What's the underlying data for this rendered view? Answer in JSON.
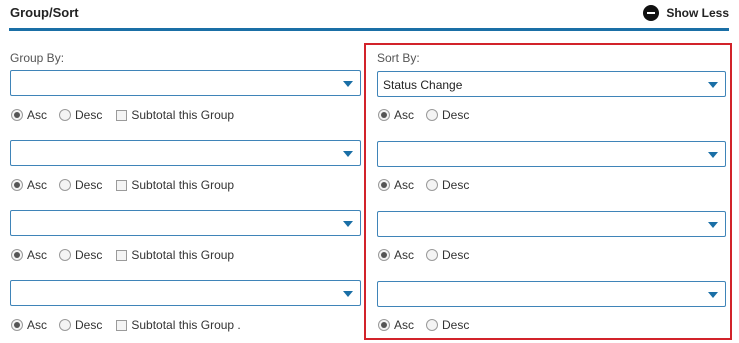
{
  "header": {
    "title": "Group/Sort",
    "show_less_label": "Show Less"
  },
  "group_by": {
    "label": "Group By:",
    "rows": [
      {
        "selected": "",
        "asc_label": "Asc",
        "desc_label": "Desc",
        "subtotal_label": "Subtotal this Group",
        "order": "asc",
        "subtotal": false
      },
      {
        "selected": "",
        "asc_label": "Asc",
        "desc_label": "Desc",
        "subtotal_label": "Subtotal this Group",
        "order": "asc",
        "subtotal": false
      },
      {
        "selected": "",
        "asc_label": "Asc",
        "desc_label": "Desc",
        "subtotal_label": "Subtotal this Group",
        "order": "asc",
        "subtotal": false
      },
      {
        "selected": "",
        "asc_label": "Asc",
        "desc_label": "Desc",
        "subtotal_label": "Subtotal this Group .",
        "order": "asc",
        "subtotal": false
      }
    ]
  },
  "sort_by": {
    "label": "Sort By:",
    "rows": [
      {
        "selected": "Status Change",
        "asc_label": "Asc",
        "desc_label": "Desc",
        "order": "asc"
      },
      {
        "selected": "",
        "asc_label": "Asc",
        "desc_label": "Desc",
        "order": "asc"
      },
      {
        "selected": "",
        "asc_label": "Asc",
        "desc_label": "Desc",
        "order": "asc"
      },
      {
        "selected": "",
        "asc_label": "Asc",
        "desc_label": "Desc",
        "order": "asc"
      }
    ]
  },
  "icons": {
    "show_less": "minus-circle-icon",
    "dropdown": "caret-down-icon"
  },
  "colors": {
    "accent": "#1a6fa6",
    "highlight": "#d2232a"
  }
}
